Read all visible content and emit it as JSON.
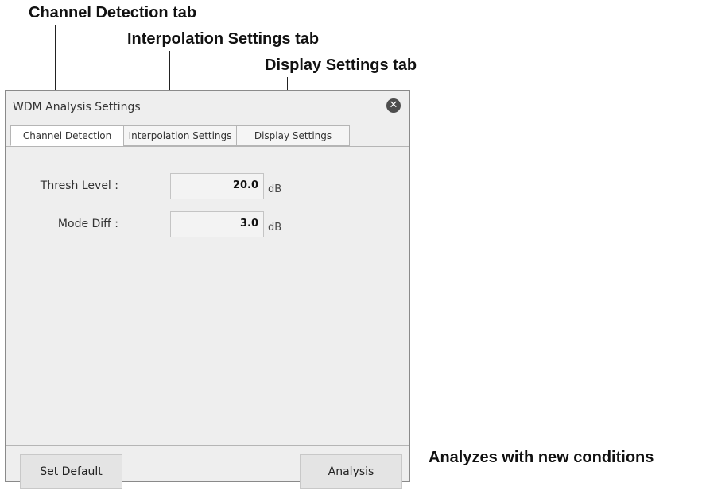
{
  "callouts": {
    "channel_detection": "Channel Detection tab",
    "interpolation_settings": "Interpolation Settings tab",
    "display_settings": "Display Settings tab",
    "analysis": "Analyzes with new conditions"
  },
  "dialog": {
    "title": "WDM Analysis Settings",
    "close_icon": "close-icon",
    "close_glyph": "✕",
    "tabs": [
      {
        "label": "Channel Detection",
        "active": true
      },
      {
        "label": "Interpolation Settings",
        "active": false
      },
      {
        "label": "Display Settings",
        "active": false
      }
    ],
    "fields": [
      {
        "label": "Thresh Level :",
        "value": "20.0",
        "unit": "dB"
      },
      {
        "label": "Mode Diff :",
        "value": "3.0",
        "unit": "dB"
      }
    ],
    "buttons": {
      "set_default": "Set Default",
      "analysis": "Analysis"
    }
  }
}
